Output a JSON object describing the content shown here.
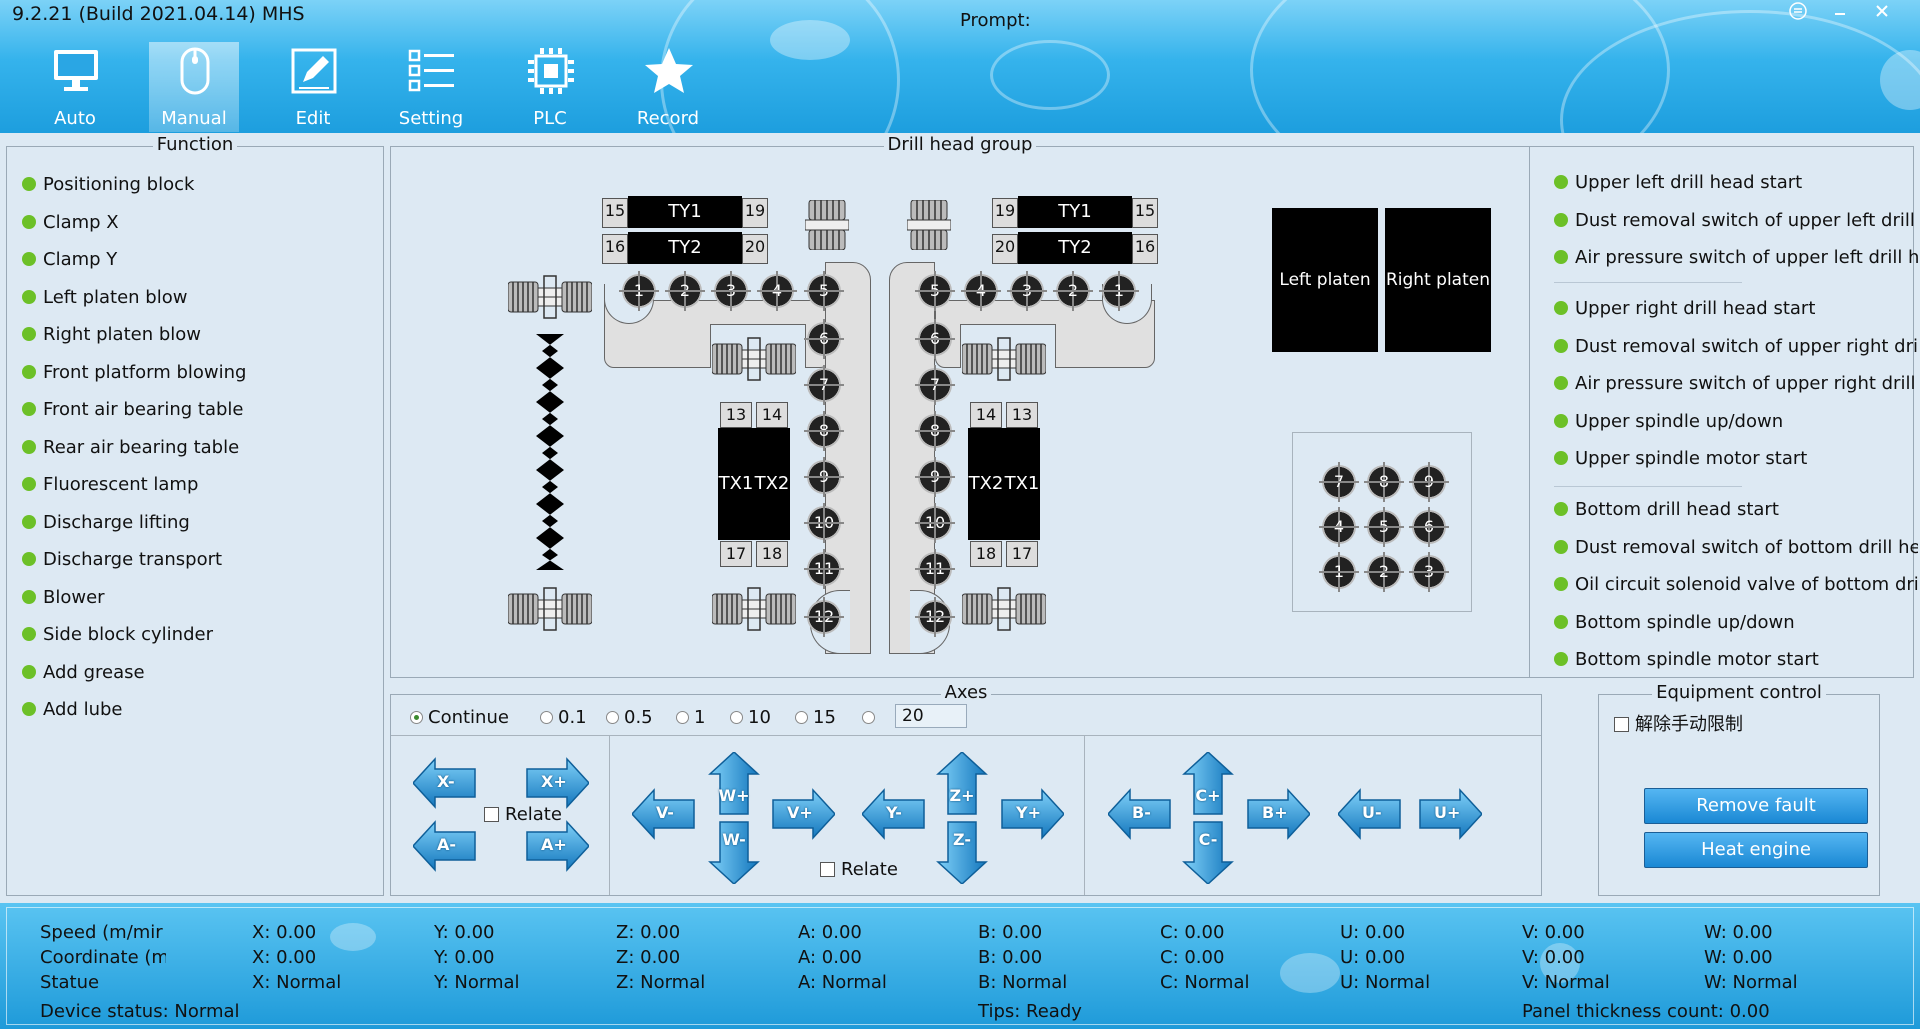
{
  "window": {
    "title": "9.2.21 (Build 2021.04.14) MHS",
    "prompt_label": "Prompt:",
    "prompt_value": ""
  },
  "nav": [
    {
      "id": "auto",
      "label": "Auto",
      "icon": "monitor-icon"
    },
    {
      "id": "manual",
      "label": "Manual",
      "icon": "mouse-icon",
      "active": true
    },
    {
      "id": "edit",
      "label": "Edit",
      "icon": "edit-icon"
    },
    {
      "id": "setting",
      "label": "Setting",
      "icon": "list-icon"
    },
    {
      "id": "plc",
      "label": "PLC",
      "icon": "chip-icon"
    },
    {
      "id": "record",
      "label": "Record",
      "icon": "star-icon"
    }
  ],
  "function_panel": {
    "title": "Function",
    "items": [
      "Positioning block",
      "Clamp X",
      "Clamp Y",
      "Left platen blow",
      "Right platen blow",
      "Front platform blowing",
      "Front air bearing table",
      "Rear air bearing table",
      "Fluorescent lamp",
      "Discharge lifting",
      "Discharge transport",
      "Blower",
      "Side block cylinder",
      "Add grease",
      "Add lube"
    ],
    "status_color": "#6cc027"
  },
  "drill_panel": {
    "title": "Drill head group",
    "ty1": "TY1",
    "ty2": "TY2",
    "tx1": "TX1",
    "tx2": "TX2",
    "num15": "15",
    "num16": "16",
    "num19": "19",
    "num20": "20",
    "num13": "13",
    "num14": "14",
    "num17": "17",
    "num18": "18",
    "left_holes_h": [
      "1",
      "2",
      "3",
      "4",
      "5"
    ],
    "right_holes_h": [
      "5",
      "4",
      "3",
      "2",
      "1"
    ],
    "holes_v": [
      "6",
      "7",
      "8",
      "9",
      "10",
      "11",
      "12"
    ],
    "left_platen": "Left platen",
    "right_platen": "Right platen",
    "keypad": [
      "7",
      "8",
      "9",
      "4",
      "5",
      "6",
      "1",
      "2",
      "3"
    ]
  },
  "drill_status": {
    "groups": [
      [
        "Upper left drill head start",
        "Dust removal switch of upper left drill head",
        "Air pressure switch of upper left drill head"
      ],
      [
        "Upper right drill head start",
        "Dust removal switch of upper right drill head",
        "Air pressure switch of upper right drill head",
        "Upper spindle up/down",
        "Upper spindle motor start"
      ],
      [
        "Bottom drill head start",
        "Dust removal switch of bottom drill head",
        "Oil circuit solenoid valve of bottom drill head",
        "Bottom spindle up/down",
        "Bottom spindle motor start"
      ]
    ]
  },
  "axes": {
    "title": "Axes",
    "modes": [
      "Continue",
      "0.1",
      "0.5",
      "1",
      "10",
      "15",
      ""
    ],
    "selected": "Continue",
    "custom_value": "20",
    "relate": "Relate",
    "buttons": {
      "x_minus": "X-",
      "x_plus": "X+",
      "a_minus": "A-",
      "a_plus": "A+",
      "v_minus": "V-",
      "v_plus": "V+",
      "w_plus": "W+",
      "w_minus": "W-",
      "y_minus": "Y-",
      "y_plus": "Y+",
      "z_plus": "Z+",
      "z_minus": "Z-",
      "b_minus": "B-",
      "b_plus": "B+",
      "c_plus": "C+",
      "c_minus": "C-",
      "u_minus": "U-",
      "u_plus": "U+"
    }
  },
  "equipment": {
    "title": "Equipment control",
    "release_limit": "解除手动限制",
    "remove_fault": "Remove fault",
    "heat_engine": "Heat engine"
  },
  "status": {
    "row_labels": [
      "Speed (m/mir",
      "Coordinate (m",
      "Statue"
    ],
    "axes": [
      "X",
      "Y",
      "Z",
      "A",
      "B",
      "C",
      "U",
      "V",
      "W"
    ],
    "speed": [
      "X: 0.00",
      "Y: 0.00",
      "Z: 0.00",
      "A: 0.00",
      "B: 0.00",
      "C: 0.00",
      "U: 0.00",
      "V: 0.00",
      "W: 0.00"
    ],
    "coordinate": [
      "X: 0.00",
      "Y: 0.00",
      "Z: 0.00",
      "A: 0.00",
      "B: 0.00",
      "C: 0.00",
      "U: 0.00",
      "V: 0.00",
      "W: 0.00"
    ],
    "statue": [
      "X: Normal",
      "Y: Normal",
      "Z: Normal",
      "A: Normal",
      "B: Normal",
      "C: Normal",
      "U: Normal",
      "V: Normal",
      "W: Normal"
    ],
    "device_status": "Device status: Normal",
    "tips": "Tips: Ready",
    "panel_count": "Panel thickness count: 0.00"
  }
}
